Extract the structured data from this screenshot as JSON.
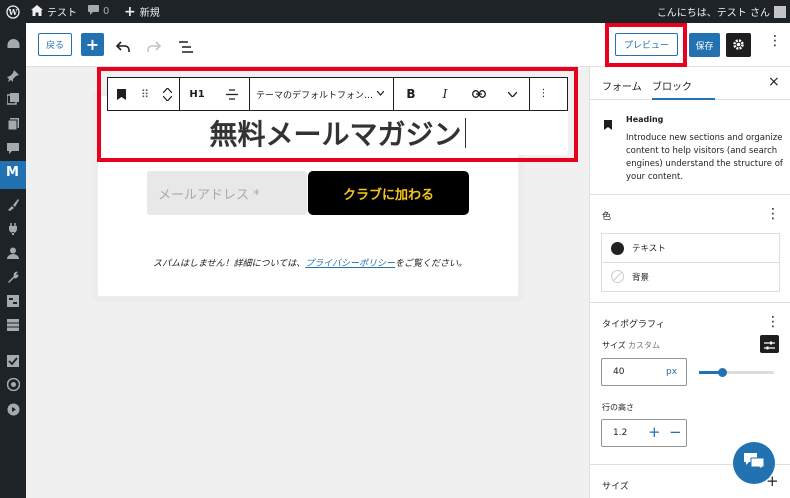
{
  "adminbar": {
    "site_name": "テスト",
    "comments_count": "0",
    "new_label": "新規",
    "greeting": "こんにちは、テスト さん"
  },
  "topbar": {
    "back_label": "戻る",
    "add_label": "+",
    "preview_label": "プレビュー",
    "save_label": "保存"
  },
  "toolbar": {
    "heading_level": "H1",
    "font_select": "テーマのデフォルトフォン…",
    "bold": "B",
    "italic": "I"
  },
  "content": {
    "heading": "無料メールマガジン",
    "email_placeholder": "メールアドレス *",
    "join_button": "クラブに加わる",
    "spam_prefix": "スパムはしません！詳細については、",
    "privacy_link": "プライバシーポリシー",
    "spam_suffix": "をご覧ください。"
  },
  "sidebar": {
    "tab_form": "フォーム",
    "tab_block": "ブロック",
    "close": "×",
    "block_name": "Heading",
    "block_desc": "Introduce new sections and organize content to help visitors (and search engines) understand the structure of your content.",
    "color_title": "色",
    "color_text": "テキスト",
    "color_bg": "背景",
    "typo_title": "タイポグラフィ",
    "size_label": "サイズ",
    "size_custom": "カスタム",
    "size_value": "40",
    "size_unit": "px",
    "slider_fraction": 0.31,
    "line_height_label": "行の高さ",
    "line_height_value": "1.2",
    "bottom_size_label": "サイズ"
  },
  "colors": {
    "accent": "#2271b1",
    "highlight": "#e8001c",
    "join_text": "#f5c518",
    "admin_bg": "#1d2327"
  }
}
